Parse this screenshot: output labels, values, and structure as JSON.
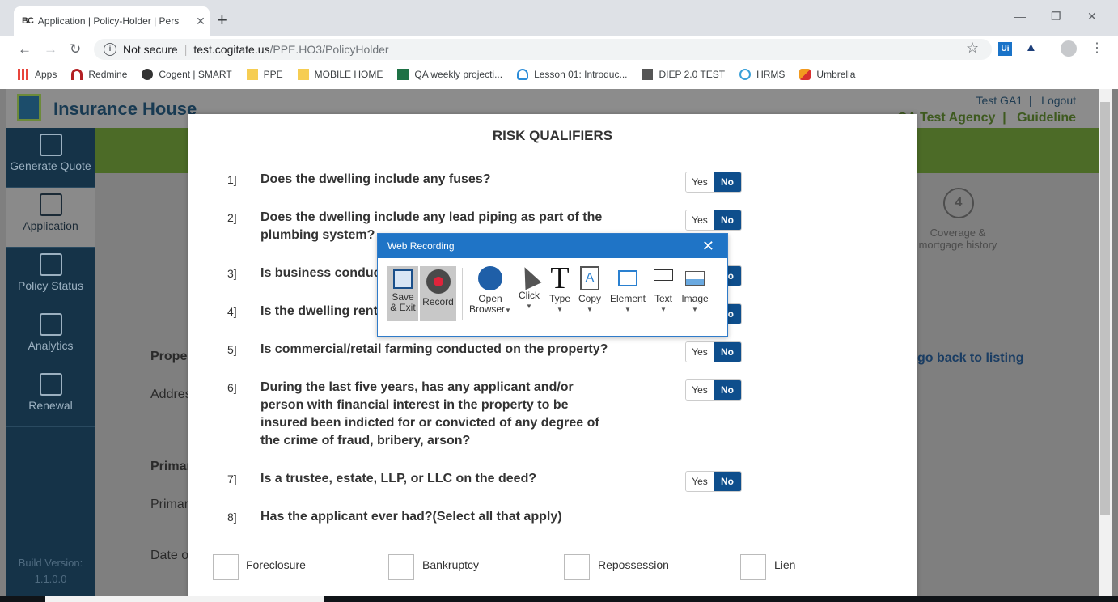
{
  "browser": {
    "tab_favicon": "BC",
    "tab_title": "Application | Policy-Holder | Pers",
    "url_security": "Not secure",
    "url_host": "test.cogitate.us",
    "url_path": "/PPE.HO3/PolicyHolder",
    "ext_ui": "Ui",
    "bookmarks": [
      {
        "label": "Apps",
        "icon": "apps-grid-icon"
      },
      {
        "label": "Redmine",
        "icon": "redmine-icon"
      },
      {
        "label": "Cogent | SMART",
        "icon": "globe-icon"
      },
      {
        "label": "PPE",
        "icon": "folder-icon"
      },
      {
        "label": "MOBILE HOME",
        "icon": "folder-icon"
      },
      {
        "label": "QA weekly projecti...",
        "icon": "excel-icon"
      },
      {
        "label": "Lesson 01: Introduc...",
        "icon": "cloud-icon"
      },
      {
        "label": "DIEP 2.0 TEST",
        "icon": "bc-icon"
      },
      {
        "label": "HRMS",
        "icon": "hrms-icon"
      },
      {
        "label": "Umbrella",
        "icon": "umbrella-icon"
      }
    ]
  },
  "app": {
    "logo_text": "Insurance House",
    "user_name": "Test GA1",
    "logout": "Logout",
    "agency": "GA Test Agency",
    "guidelines": "Guideline",
    "sidebar": [
      {
        "label": "Generate Quote"
      },
      {
        "label": "Application"
      },
      {
        "label": "Policy Status"
      },
      {
        "label": "Analytics"
      },
      {
        "label": "Renewal"
      }
    ],
    "build_label": "Build Version:",
    "build_version": "1.1.0.0",
    "step4_number": "4",
    "step4_label": "Coverage & mortgage history",
    "go_back": "go back to listing",
    "bg_property": "Proper",
    "bg_address": "Addres",
    "bg_primary_bold": "Primar",
    "bg_primary": "Primar",
    "bg_date": "Date o"
  },
  "modal": {
    "title": "RISK QUALIFIERS",
    "yes_label": "Yes",
    "no_label": "No",
    "questions": [
      {
        "num": "1]",
        "text": "Does the dwelling include any fuses?"
      },
      {
        "num": "2]",
        "text": "Does the dwelling include any lead piping as part of the plumbing system?"
      },
      {
        "num": "3]",
        "text": "Is business conduct"
      },
      {
        "num": "4]",
        "text": "Is the dwelling rente"
      },
      {
        "num": "5]",
        "text": "Is commercial/retail farming conducted on the property?"
      },
      {
        "num": "6]",
        "text": "During the last five years, has any applicant and/or person with financial interest in the property to be insured been indicted for or convicted of any degree of the crime of fraud, bribery, arson?"
      },
      {
        "num": "7]",
        "text": "Is a trustee, estate, LLP, or LLC on the deed?"
      },
      {
        "num": "8]",
        "text": "Has the applicant ever had?(Select all that apply)"
      }
    ],
    "checkboxes": [
      "Foreclosure",
      "Bankruptcy",
      "Repossession",
      "Lien"
    ]
  },
  "recorder": {
    "title": "Web Recording",
    "buttons": [
      {
        "line1": "Save",
        "line2": "& Exit",
        "icon": "floppy-disk-icon"
      },
      {
        "line1": "Record",
        "line2": "",
        "icon": "record-icon"
      },
      {
        "line1": "Open",
        "line2": "Browser",
        "icon": "globe-icon"
      },
      {
        "line1": "Click",
        "line2": "",
        "icon": "cursor-icon"
      },
      {
        "line1": "Type",
        "line2": "",
        "icon": "type-icon"
      },
      {
        "line1": "Copy",
        "line2": "",
        "icon": "copy-icon"
      },
      {
        "line1": "Element",
        "line2": "",
        "icon": "element-icon"
      },
      {
        "line1": "Text",
        "line2": "",
        "icon": "text-icon"
      },
      {
        "line1": "Image",
        "line2": "",
        "icon": "image-icon"
      }
    ]
  }
}
